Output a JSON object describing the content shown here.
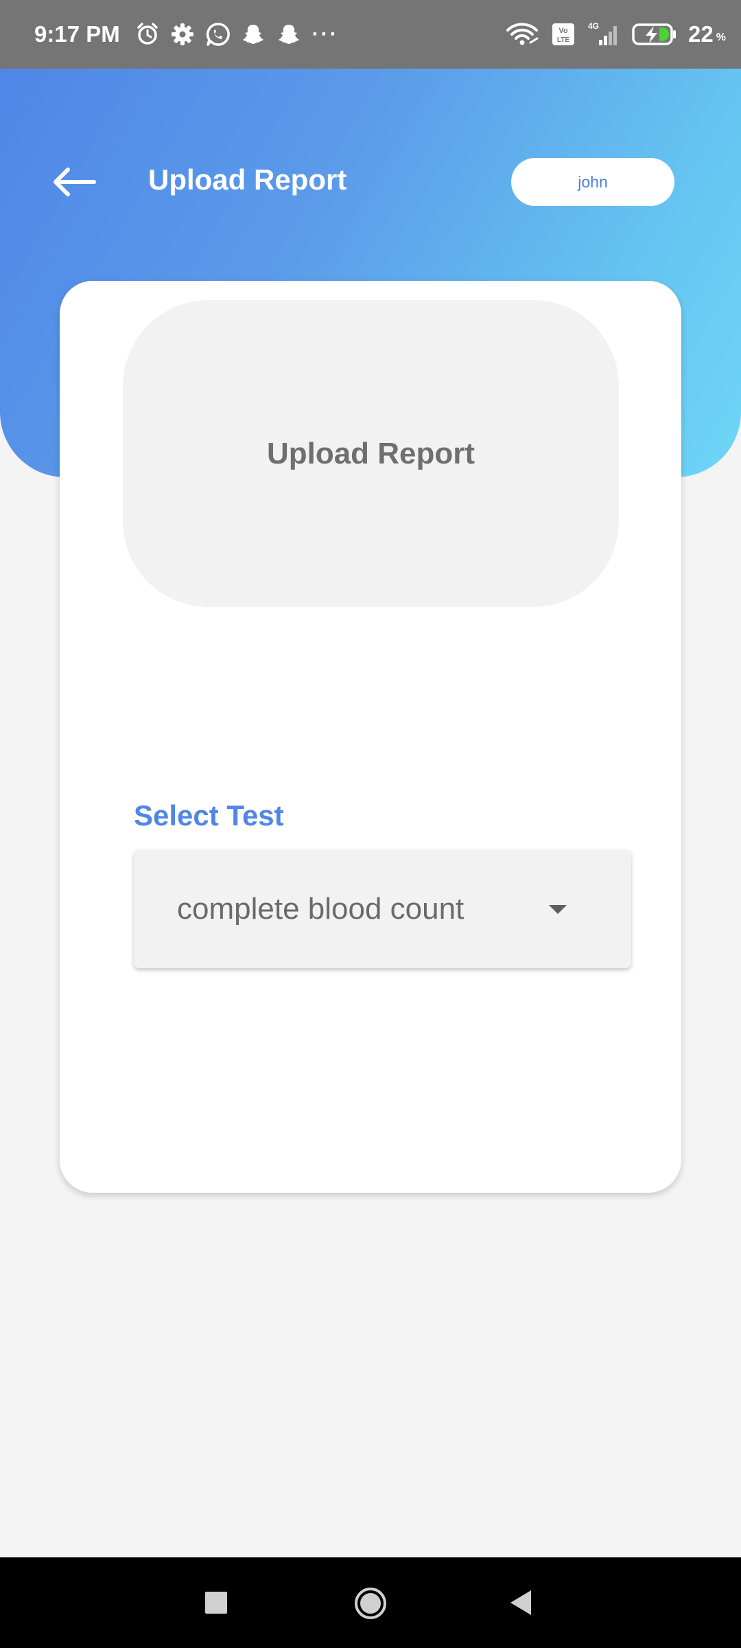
{
  "status_bar": {
    "time": "9:17 PM",
    "battery_percent": "22",
    "battery_unit": "%",
    "network_type": "4G",
    "volte_label": "Vo LTE",
    "more_indicator": "···",
    "icons": [
      "alarm-icon",
      "settings-icon",
      "whatsapp-icon",
      "snapchat-icon",
      "snapchat-icon",
      "wifi-icon",
      "volte-icon",
      "signal-icon",
      "battery-charging-icon"
    ]
  },
  "header": {
    "title": "Upload Report",
    "user_name": "john",
    "back_icon": "arrow-left-icon"
  },
  "upload": {
    "label": "Upload Report"
  },
  "test_select": {
    "label": "Select Test",
    "selected_value": "complete blood count",
    "caret_icon": "caret-down-icon"
  },
  "nav_bar": {
    "icons": [
      "recents-icon",
      "home-icon",
      "back-icon"
    ]
  },
  "colors": {
    "status_bar": "#757575",
    "gradient_start": "#4f86e8",
    "gradient_end": "#6fd6f6",
    "accent": "#4f86e8",
    "card": "#ffffff",
    "background": "#f4f4f4",
    "field": "#f2f2f2",
    "battery_fill": "#4cd137"
  }
}
